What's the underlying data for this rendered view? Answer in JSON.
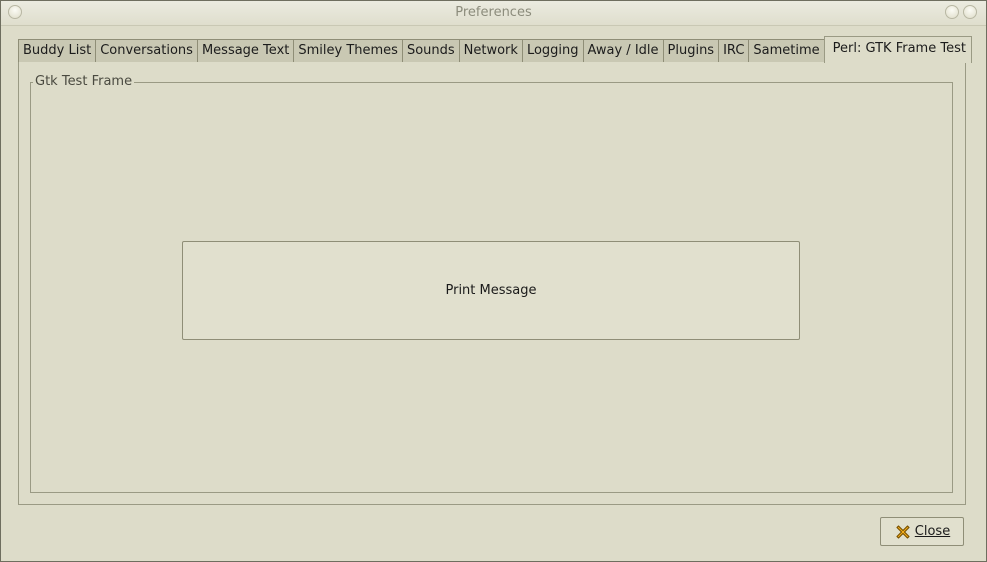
{
  "window": {
    "title": "Preferences"
  },
  "tabs": [
    {
      "label": "Buddy List"
    },
    {
      "label": "Conversations"
    },
    {
      "label": "Message Text"
    },
    {
      "label": "Smiley Themes"
    },
    {
      "label": "Sounds"
    },
    {
      "label": "Network"
    },
    {
      "label": "Logging"
    },
    {
      "label": "Away / Idle"
    },
    {
      "label": "Plugins"
    },
    {
      "label": "IRC"
    },
    {
      "label": "Sametime"
    },
    {
      "label": "Perl: GTK Frame Test",
      "active": true
    }
  ],
  "frame": {
    "label": "Gtk Test Frame",
    "button_label": "Print Message"
  },
  "footer": {
    "close_label": "Close"
  },
  "colors": {
    "background": "#dddcc9",
    "tab_inactive": "#c9c8b3",
    "border": "#9a9a84"
  }
}
